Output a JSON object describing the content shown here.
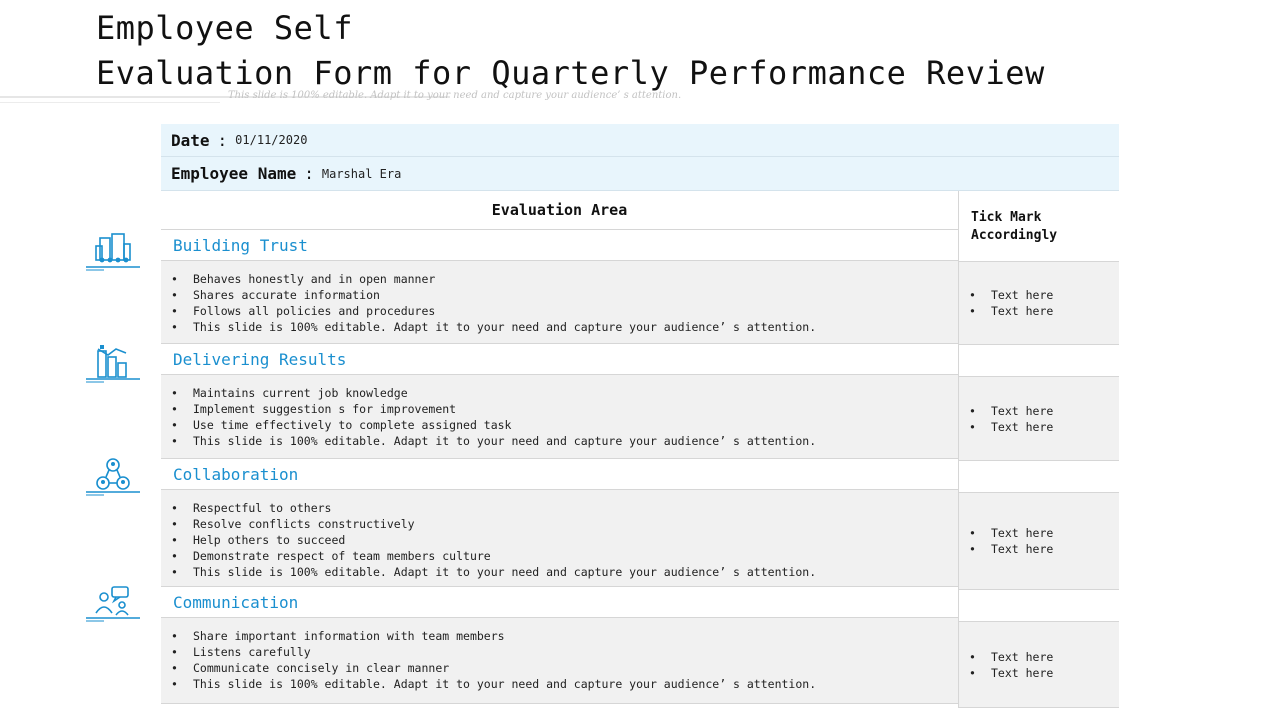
{
  "slide": {
    "title_line1": "Employee Self",
    "title_line2": "Evaluation Form for Quarterly Performance Review",
    "subtitle": "This slide is 100% editable. Adapt it to your need and capture your audience’ s attention."
  },
  "form": {
    "date_label": "Date",
    "date_value": "01/11/2020",
    "name_label": "Employee Name",
    "name_value": "Marshal Era",
    "area_header": "Evaluation Area",
    "tick_header_line1": "Tick Mark",
    "tick_header_line2": "Accordingly",
    "sections": [
      {
        "icon": "building-icon",
        "title": "Building Trust",
        "items": [
          "Behaves honestly and in open manner",
          "Shares accurate information",
          "Follows all policies and procedures",
          "This slide is 100% editable. Adapt it to your need and capture your audience’ s attention."
        ],
        "ticks": [
          "Text here",
          "Text here"
        ]
      },
      {
        "icon": "city-chart-icon",
        "title": "Delivering Results",
        "items": [
          "Maintains current job knowledge",
          "Implement suggestion s for improvement",
          "Use time effectively to complete assigned task",
          "This slide is 100% editable. Adapt it to your need and capture your audience’ s attention."
        ],
        "ticks": [
          "Text here",
          "Text here"
        ]
      },
      {
        "icon": "team-network-icon",
        "title": "Collaboration",
        "items": [
          "Respectful to others",
          "Resolve conflicts constructively",
          "Help others to succeed",
          "Demonstrate respect of team members culture",
          "This slide is 100% editable. Adapt it to your need and capture your audience’ s attention."
        ],
        "ticks": [
          "Text here",
          "Text here"
        ]
      },
      {
        "icon": "communication-icon",
        "title": "Communication",
        "items": [
          "Share important information with team members",
          "Listens carefully",
          "Communicate concisely in clear manner",
          "This slide is 100% editable. Adapt it to your need and capture your audience’ s attention."
        ],
        "ticks": [
          "Text here",
          "Text here"
        ]
      }
    ]
  },
  "colors": {
    "accent": "#1a8fcf",
    "header_bg": "#e8f5fc",
    "row_bg": "#f1f1f1"
  }
}
